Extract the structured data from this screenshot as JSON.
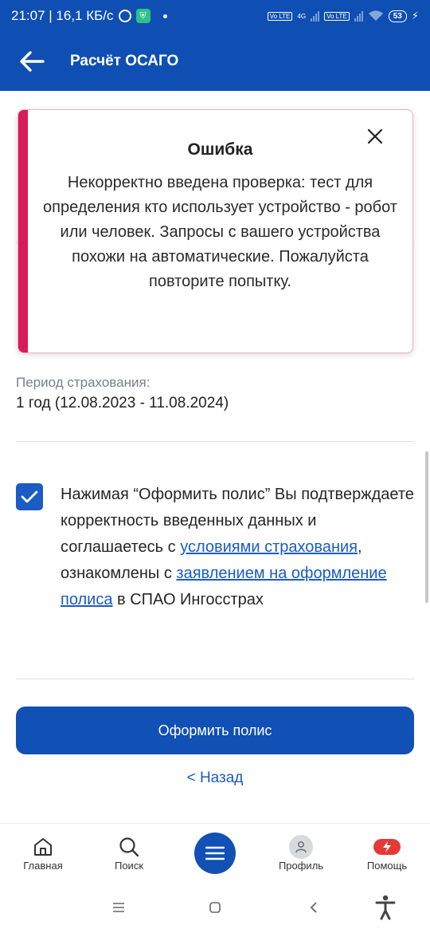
{
  "status_bar": {
    "time_speed": "21:07 | 16,1 КБ/с",
    "network_4g": "4G",
    "volte1": "Vo LTE",
    "volte2": "Vo LTE",
    "battery": "53"
  },
  "header": {
    "title": "Расчёт ОСАГО"
  },
  "insurance": {
    "period_label": "Период страхования:",
    "period_value": "1 год (12.08.2023 - 11.08.2024)"
  },
  "consent": {
    "checked": true,
    "text_1": "Нажимая “Оформить полис” Вы подтверждаете корректность введенных данных и соглашаетесь с ",
    "link_terms": "условиями страхования",
    "text_2": ", ознакомлены с ",
    "link_statement": "заявлением на оформление полиса",
    "text_3": " в СПАО Ингосстрах"
  },
  "actions": {
    "submit_label": "Оформить полис",
    "back_label": "< Назад"
  },
  "bottom_nav": {
    "home": "Главная",
    "search": "Поиск",
    "profile": "Профиль",
    "help": "Помощь"
  },
  "error_toast": {
    "title": "Ошибка",
    "message": "Некорректно введена проверка: тест для определения кто использует устройство - робот или человек. Запросы с вашего устройства похожи на автоматические. Пожалуйста повторите попытку."
  },
  "colors": {
    "brand_blue": "#0f4fb4",
    "error_accent": "#d81b5a",
    "link": "#1a5bc4"
  }
}
